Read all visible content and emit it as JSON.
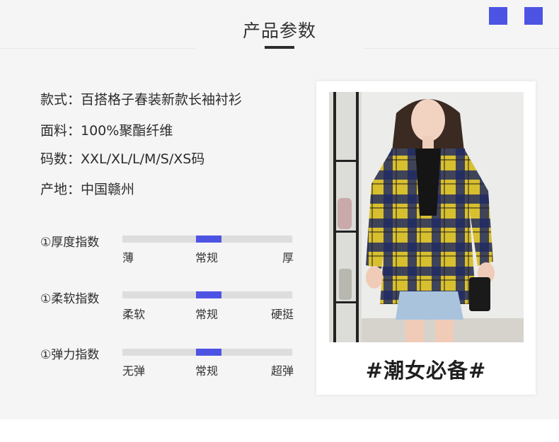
{
  "header": {
    "title": "产品参数"
  },
  "accent_color": "#4d54e3",
  "specs": [
    "款式：百搭格子春装新款长袖衬衫",
    "面料：100%聚酯纤维",
    "码数：XXL/XL/L/M/S/XS码",
    "产地：中国赣州"
  ],
  "ratings": [
    {
      "label": "①厚度指数",
      "low": "薄",
      "mid": "常规",
      "high": "厚",
      "level": 0.5
    },
    {
      "label": "①柔软指数",
      "low": "柔软",
      "mid": "常规",
      "high": "硬挺",
      "level": 0.5
    },
    {
      "label": "①弹力指数",
      "low": "无弹",
      "mid": "常规",
      "high": "超弹",
      "level": 0.5
    }
  ],
  "product_card": {
    "caption": "#潮女必备#"
  }
}
